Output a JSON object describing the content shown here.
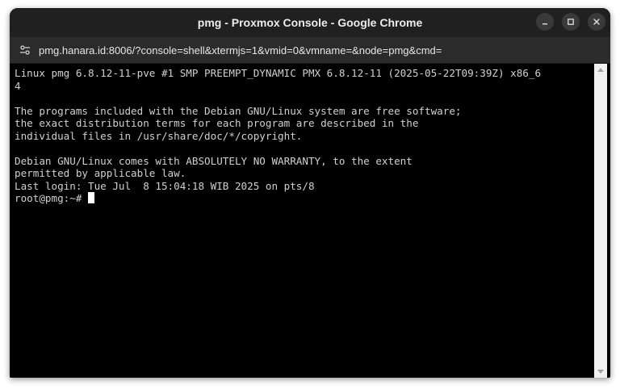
{
  "window": {
    "title": "pmg - Proxmox Console - Google Chrome"
  },
  "address_bar": {
    "url": "pmg.hanara.id:8006/?console=shell&xtermjs=1&vmid=0&vmname=&node=pmg&cmd="
  },
  "terminal": {
    "lines": [
      "Linux pmg 6.8.12-11-pve #1 SMP PREEMPT_DYNAMIC PMX 6.8.12-11 (2025-05-22T09:39Z) x86_6",
      "4",
      "",
      "The programs included with the Debian GNU/Linux system are free software;",
      "the exact distribution terms for each program are described in the",
      "individual files in /usr/share/doc/*/copyright.",
      "",
      "Debian GNU/Linux comes with ABSOLUTELY NO WARRANTY, to the extent",
      "permitted by applicable law.",
      "Last login: Tue Jul  8 15:04:18 WIB 2025 on pts/8"
    ],
    "prompt": "root@pmg:~# "
  },
  "icons": {
    "site_info": "tune-icon",
    "minimize": "minimize-icon",
    "maximize": "maximize-icon",
    "close": "close-icon"
  }
}
